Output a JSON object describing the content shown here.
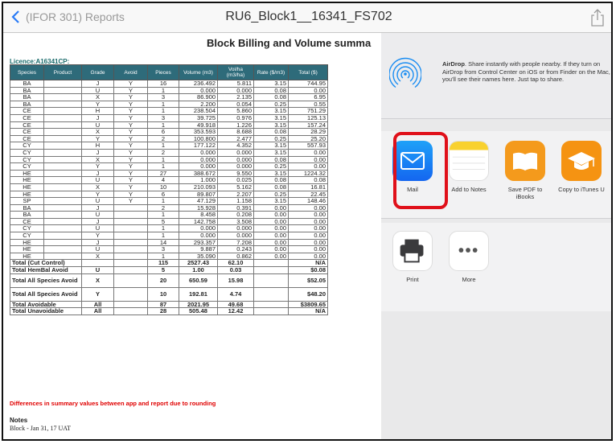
{
  "nav": {
    "back_label": "(IFOR 301) Reports",
    "title": "RU6_Block1__16341_FS702"
  },
  "report": {
    "title": "Block Billing and Volume summa",
    "licence": "Licence:A16341CP:",
    "columns": [
      "Species",
      "Product",
      "Grade",
      "Avoid",
      "Pieces",
      "Volume (m3)",
      "Vol/ha (m3/ha)",
      "Rate ($/m3)",
      "Total ($)"
    ],
    "rows": [
      [
        "BA",
        "",
        "J",
        "Y",
        "16",
        "236.492",
        "5.811",
        "3.15",
        "744.95"
      ],
      [
        "BA",
        "",
        "U",
        "Y",
        "1",
        "0.000",
        "0.000",
        "0.08",
        "0.00"
      ],
      [
        "BA",
        "",
        "X",
        "Y",
        "3",
        "86.900",
        "2.135",
        "0.08",
        "6.95"
      ],
      [
        "BA",
        "",
        "Y",
        "Y",
        "1",
        "2.200",
        "0.054",
        "0.25",
        "0.55"
      ],
      [
        "CE",
        "",
        "H",
        "Y",
        "1",
        "238.504",
        "5.860",
        "3.15",
        "751.29"
      ],
      [
        "CE",
        "",
        "J",
        "Y",
        "3",
        "39.725",
        "0.976",
        "3.15",
        "125.13"
      ],
      [
        "CE",
        "",
        "U",
        "Y",
        "1",
        "49.918",
        "1.226",
        "3.15",
        "157.24"
      ],
      [
        "CE",
        "",
        "X",
        "Y",
        "6",
        "353.593",
        "8.688",
        "0.08",
        "28.29"
      ],
      [
        "CE",
        "",
        "Y",
        "Y",
        "2",
        "100.800",
        "2.477",
        "0.25",
        "25.20"
      ],
      [
        "CY",
        "",
        "H",
        "Y",
        "1",
        "177.122",
        "4.352",
        "3.15",
        "557.93"
      ],
      [
        "CY",
        "",
        "J",
        "Y",
        "2",
        "0.000",
        "0.000",
        "3.15",
        "0.00"
      ],
      [
        "CY",
        "",
        "X",
        "Y",
        "1",
        "0.000",
        "0.000",
        "0.08",
        "0.00"
      ],
      [
        "CY",
        "",
        "Y",
        "Y",
        "1",
        "0.000",
        "0.000",
        "0.25",
        "0.00"
      ],
      [
        "HE",
        "",
        "J",
        "Y",
        "27",
        "388.672",
        "9.550",
        "3.15",
        "1224.32"
      ],
      [
        "HE",
        "",
        "U",
        "Y",
        "4",
        "1.000",
        "0.025",
        "0.08",
        "0.08"
      ],
      [
        "HE",
        "",
        "X",
        "Y",
        "10",
        "210.093",
        "5.162",
        "0.08",
        "16.81"
      ],
      [
        "HE",
        "",
        "Y",
        "Y",
        "6",
        "89.807",
        "2.207",
        "0.25",
        "22.45"
      ],
      [
        "SP",
        "",
        "U",
        "Y",
        "1",
        "47.129",
        "1.158",
        "3.15",
        "148.46"
      ],
      [
        "BA",
        "",
        "J",
        "",
        "2",
        "15.928",
        "0.391",
        "0.00",
        "0.00"
      ],
      [
        "BA",
        "",
        "U",
        "",
        "1",
        "8.458",
        "0.208",
        "0.00",
        "0.00"
      ],
      [
        "CE",
        "",
        "J",
        "",
        "5",
        "142.758",
        "3.508",
        "0.00",
        "0.00"
      ],
      [
        "CY",
        "",
        "U",
        "",
        "1",
        "0.000",
        "0.000",
        "0.00",
        "0.00"
      ],
      [
        "CY",
        "",
        "Y",
        "",
        "1",
        "0.000",
        "0.000",
        "0.00",
        "0.00"
      ],
      [
        "HE",
        "",
        "J",
        "",
        "14",
        "293.357",
        "7.208",
        "0.00",
        "0.00"
      ],
      [
        "HE",
        "",
        "U",
        "",
        "3",
        "9.887",
        "0.243",
        "0.00",
        "0.00"
      ],
      [
        "HE",
        "",
        "X",
        "",
        "1",
        "35.090",
        "0.862",
        "0.00",
        "0.00"
      ]
    ],
    "totals": [
      {
        "label": "Total (Cut Control)",
        "grade": "",
        "pieces": "115",
        "volume": "2527.43",
        "volha": "62.10",
        "rate": "",
        "total": "N/A"
      },
      {
        "label": "Total HemBal Avoid",
        "grade": "U",
        "pieces": "5",
        "volume": "1.00",
        "volha": "0.03",
        "rate": "",
        "total": "$0.08"
      },
      {
        "label": "Total All Species Avoid",
        "grade": "X",
        "pieces": "20",
        "volume": "650.59",
        "volha": "15.98",
        "rate": "",
        "total": "$52.05"
      },
      {
        "label": "Total All Species Avoid",
        "grade": "Y",
        "pieces": "10",
        "volume": "192.81",
        "volha": "4.74",
        "rate": "",
        "total": "$48.20"
      },
      {
        "label": "Total Avoidable",
        "grade": "All",
        "pieces": "87",
        "volume": "2021.95",
        "volha": "49.68",
        "rate": "",
        "total": "$3809.65"
      },
      {
        "label": "Total Unavoidable",
        "grade": "All",
        "pieces": "28",
        "volume": "505.48",
        "volha": "12.42",
        "rate": "",
        "total": "N/A"
      }
    ],
    "diff_note": "Differences in summary values between app and report due to rounding",
    "notes_heading": "Notes",
    "notes_text": "Block - Jan 31, 17 UAT"
  },
  "share": {
    "airdrop_title": "AirDrop",
    "airdrop_desc": ". Share instantly with people nearby. If they turn on AirDrop from Control Center on iOS or from Finder on the Mac, you'll see their names here. Just tap to share.",
    "apps": [
      {
        "label": "Mail",
        "icon": "mail-icon"
      },
      {
        "label": "Add to Notes",
        "icon": "notes-icon"
      },
      {
        "label": "Save PDF to iBooks",
        "icon": "ibooks-icon"
      },
      {
        "label": "Copy to iTunes U",
        "icon": "itunes-u-icon"
      }
    ],
    "actions": [
      {
        "label": "Print",
        "icon": "print-icon"
      },
      {
        "label": "More",
        "icon": "more-icon"
      }
    ],
    "highlight_color": "#e0101a"
  }
}
